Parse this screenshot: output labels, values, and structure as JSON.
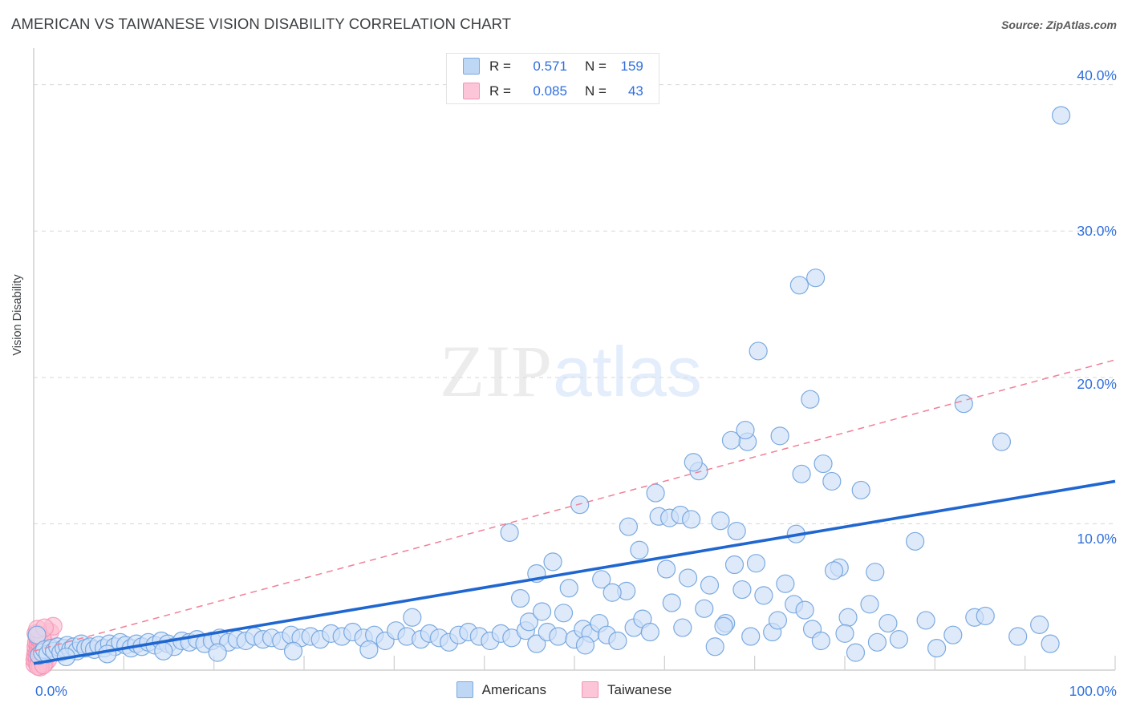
{
  "header": {
    "title": "AMERICAN VS TAIWANESE VISION DISABILITY CORRELATION CHART",
    "source": "Source: ZipAtlas.com"
  },
  "watermark": {
    "part1": "ZIP",
    "part2": "atlas"
  },
  "stats_legend": {
    "rows": [
      {
        "series": "Americans",
        "color": "#bdd7f5",
        "r_key": "R =",
        "r_value": "0.571",
        "n_key": "N =",
        "n_value": "159"
      },
      {
        "series": "Taiwanese",
        "color": "#fcc6d8",
        "r_key": "R =",
        "r_value": "0.085",
        "n_key": "N =",
        "n_value": "43"
      }
    ]
  },
  "bottom_legend": {
    "items": [
      {
        "label": "Americans",
        "color": "#bdd7f5",
        "border": "#7aa9e0"
      },
      {
        "label": "Taiwanese",
        "color": "#fcc6d8",
        "border": "#f194b4"
      }
    ]
  },
  "colors": {
    "marker_blue_fill": "#cfe0f7",
    "marker_blue_stroke": "#6fa2dd",
    "marker_pink_fill": "#fbbdd2",
    "marker_pink_stroke": "#f28cae",
    "trend_blue": "#1f66d0",
    "trend_pink": "#f08098",
    "axis_label": "#2f6fdd",
    "grid": "#d8d8d8"
  },
  "chart_data": {
    "type": "scatter",
    "title": "AMERICAN VS TAIWANESE VISION DISABILITY CORRELATION CHART",
    "xlabel": "",
    "ylabel": "Vision Disability",
    "xlim": [
      0,
      100
    ],
    "ylim": [
      0,
      42.5
    ],
    "grid": true,
    "legend_position": "bottom-center",
    "x_ticks": [
      "0.0%",
      "100.0%"
    ],
    "y_ticks": [
      "10.0%",
      "20.0%",
      "30.0%",
      "40.0%"
    ],
    "y_tick_values": [
      10,
      20,
      30,
      40
    ],
    "series": [
      {
        "name": "Americans",
        "marker_color": "#cfe0f7",
        "r": 0.571,
        "n": 159,
        "trendline": {
          "style": "solid",
          "color": "#1f66d0",
          "x0": 0,
          "y0": 0.45,
          "x1": 100,
          "y1": 12.9
        },
        "points": [
          [
            0.3,
            2.4
          ],
          [
            0.5,
            1.0
          ],
          [
            0.8,
            1.2
          ],
          [
            1.0,
            1.4
          ],
          [
            1.3,
            1.1
          ],
          [
            1.6,
            1.5
          ],
          [
            1.9,
            1.3
          ],
          [
            2.2,
            1.6
          ],
          [
            2.5,
            1.2
          ],
          [
            2.8,
            1.5
          ],
          [
            3.1,
            1.7
          ],
          [
            3.4,
            1.4
          ],
          [
            3.7,
            1.6
          ],
          [
            4.0,
            1.3
          ],
          [
            4.4,
            1.8
          ],
          [
            4.8,
            1.5
          ],
          [
            5.2,
            1.6
          ],
          [
            5.6,
            1.4
          ],
          [
            6.0,
            1.7
          ],
          [
            6.5,
            1.5
          ],
          [
            7.0,
            1.8
          ],
          [
            7.5,
            1.6
          ],
          [
            8.0,
            1.9
          ],
          [
            8.5,
            1.7
          ],
          [
            9.0,
            1.5
          ],
          [
            9.5,
            1.8
          ],
          [
            10.0,
            1.6
          ],
          [
            10.6,
            1.9
          ],
          [
            11.2,
            1.7
          ],
          [
            11.8,
            2.0
          ],
          [
            12.4,
            1.8
          ],
          [
            13.0,
            1.6
          ],
          [
            13.7,
            2.0
          ],
          [
            14.4,
            1.9
          ],
          [
            15.1,
            2.1
          ],
          [
            15.8,
            1.8
          ],
          [
            16.5,
            2.0
          ],
          [
            17.2,
            2.2
          ],
          [
            18.0,
            1.9
          ],
          [
            18.8,
            2.1
          ],
          [
            19.6,
            2.0
          ],
          [
            20.4,
            2.3
          ],
          [
            21.2,
            2.1
          ],
          [
            22.0,
            2.2
          ],
          [
            22.9,
            2.0
          ],
          [
            23.8,
            2.4
          ],
          [
            24.7,
            2.2
          ],
          [
            25.6,
            2.3
          ],
          [
            26.5,
            2.1
          ],
          [
            27.5,
            2.5
          ],
          [
            28.5,
            2.3
          ],
          [
            29.5,
            2.6
          ],
          [
            30.5,
            2.2
          ],
          [
            31.5,
            2.4
          ],
          [
            32.5,
            2.0
          ],
          [
            33.5,
            2.7
          ],
          [
            34.5,
            2.3
          ],
          [
            35.0,
            3.6
          ],
          [
            35.8,
            2.1
          ],
          [
            36.6,
            2.5
          ],
          [
            37.5,
            2.2
          ],
          [
            38.4,
            1.9
          ],
          [
            39.3,
            2.4
          ],
          [
            40.2,
            2.6
          ],
          [
            41.2,
            2.3
          ],
          [
            42.2,
            2.0
          ],
          [
            43.2,
            2.5
          ],
          [
            44.2,
            2.2
          ],
          [
            45.0,
            4.9
          ],
          [
            45.5,
            2.7
          ],
          [
            46.5,
            1.8
          ],
          [
            47.5,
            2.6
          ],
          [
            48.5,
            2.3
          ],
          [
            49.0,
            3.9
          ],
          [
            50.0,
            2.1
          ],
          [
            50.8,
            2.8
          ],
          [
            51.5,
            2.5
          ],
          [
            52.3,
            3.2
          ],
          [
            53.0,
            2.4
          ],
          [
            54.0,
            2.0
          ],
          [
            54.8,
            5.4
          ],
          [
            55.5,
            2.9
          ],
          [
            56.3,
            3.5
          ],
          [
            57.0,
            2.6
          ],
          [
            44.0,
            9.4
          ],
          [
            46.5,
            6.6
          ],
          [
            48.0,
            7.4
          ],
          [
            49.5,
            5.6
          ],
          [
            50.5,
            11.3
          ],
          [
            52.5,
            6.2
          ],
          [
            53.5,
            5.3
          ],
          [
            55.0,
            9.8
          ],
          [
            56.0,
            8.2
          ],
          [
            57.5,
            12.1
          ],
          [
            58.5,
            6.9
          ],
          [
            59.0,
            4.6
          ],
          [
            60.0,
            2.9
          ],
          [
            60.5,
            6.3
          ],
          [
            61.5,
            13.6
          ],
          [
            62.5,
            5.8
          ],
          [
            63.0,
            1.6
          ],
          [
            64.0,
            3.2
          ],
          [
            64.8,
            7.2
          ],
          [
            65.5,
            5.5
          ],
          [
            66.3,
            2.3
          ],
          [
            57.8,
            10.5
          ],
          [
            58.8,
            10.4
          ],
          [
            59.8,
            10.6
          ],
          [
            60.8,
            10.3
          ],
          [
            61.0,
            14.2
          ],
          [
            63.5,
            10.2
          ],
          [
            62.0,
            4.2
          ],
          [
            63.8,
            3.0
          ],
          [
            65.0,
            9.5
          ],
          [
            66.0,
            15.6
          ],
          [
            66.8,
            7.3
          ],
          [
            67.5,
            5.1
          ],
          [
            68.3,
            2.6
          ],
          [
            64.5,
            15.7
          ],
          [
            65.8,
            16.4
          ],
          [
            67.0,
            21.8
          ],
          [
            68.8,
            3.4
          ],
          [
            69.5,
            5.9
          ],
          [
            70.3,
            4.5
          ],
          [
            69.0,
            16.0
          ],
          [
            70.5,
            9.3
          ],
          [
            71.3,
            4.1
          ],
          [
            72.0,
            2.8
          ],
          [
            72.8,
            2.0
          ],
          [
            70.8,
            26.3
          ],
          [
            72.3,
            26.8
          ],
          [
            71.8,
            18.5
          ],
          [
            73.0,
            14.1
          ],
          [
            73.8,
            12.9
          ],
          [
            74.5,
            7.0
          ],
          [
            75.3,
            3.6
          ],
          [
            76.0,
            1.2
          ],
          [
            71.0,
            13.4
          ],
          [
            74.0,
            6.8
          ],
          [
            75.0,
            2.5
          ],
          [
            76.5,
            12.3
          ],
          [
            77.3,
            4.5
          ],
          [
            78.0,
            1.9
          ],
          [
            77.8,
            6.7
          ],
          [
            79.0,
            3.2
          ],
          [
            80.0,
            2.1
          ],
          [
            81.5,
            8.8
          ],
          [
            82.5,
            3.4
          ],
          [
            83.5,
            1.5
          ],
          [
            85.0,
            2.4
          ],
          [
            86.0,
            18.2
          ],
          [
            87.0,
            3.6
          ],
          [
            88.0,
            3.7
          ],
          [
            89.5,
            15.6
          ],
          [
            91.0,
            2.3
          ],
          [
            95.0,
            37.9
          ],
          [
            93.0,
            3.1
          ],
          [
            94.0,
            1.8
          ],
          [
            45.8,
            3.3
          ],
          [
            47.0,
            4.0
          ],
          [
            51.0,
            1.7
          ],
          [
            31.0,
            1.4
          ],
          [
            24.0,
            1.3
          ],
          [
            17.0,
            1.2
          ],
          [
            12.0,
            1.3
          ],
          [
            6.8,
            1.1
          ],
          [
            3.0,
            0.9
          ]
        ]
      },
      {
        "name": "Taiwanese",
        "marker_color": "#fbbdd2",
        "r": 0.085,
        "n": 43,
        "trendline": {
          "style": "dashed",
          "color": "#f08098",
          "x0": 0,
          "y0": 1.3,
          "x1": 100,
          "y1": 21.2
        },
        "points": [
          [
            0.1,
            0.4
          ],
          [
            0.1,
            0.7
          ],
          [
            0.15,
            1.0
          ],
          [
            0.2,
            1.3
          ],
          [
            0.2,
            1.6
          ],
          [
            0.25,
            1.9
          ],
          [
            0.3,
            0.5
          ],
          [
            0.3,
            0.9
          ],
          [
            0.35,
            1.2
          ],
          [
            0.4,
            1.5
          ],
          [
            0.4,
            1.8
          ],
          [
            0.45,
            2.1
          ],
          [
            0.5,
            0.6
          ],
          [
            0.5,
            1.0
          ],
          [
            0.55,
            1.4
          ],
          [
            0.6,
            1.7
          ],
          [
            0.6,
            2.0
          ],
          [
            0.65,
            0.3
          ],
          [
            0.7,
            0.8
          ],
          [
            0.7,
            1.1
          ],
          [
            0.75,
            1.5
          ],
          [
            0.8,
            1.9
          ],
          [
            0.85,
            0.6
          ],
          [
            0.9,
            1.0
          ],
          [
            0.95,
            1.4
          ],
          [
            1.0,
            1.8
          ],
          [
            1.05,
            0.5
          ],
          [
            1.1,
            0.9
          ],
          [
            1.15,
            1.3
          ],
          [
            1.2,
            1.7
          ],
          [
            1.3,
            0.7
          ],
          [
            1.4,
            1.1
          ],
          [
            1.5,
            2.6
          ],
          [
            0.2,
            2.5
          ],
          [
            0.3,
            2.3
          ],
          [
            0.5,
            2.4
          ],
          [
            0.8,
            2.2
          ],
          [
            1.8,
            3.0
          ],
          [
            0.6,
            0.2
          ],
          [
            0.4,
            0.25
          ],
          [
            0.35,
            2.8
          ],
          [
            0.9,
            0.35
          ],
          [
            1.0,
            2.9
          ]
        ]
      }
    ]
  }
}
